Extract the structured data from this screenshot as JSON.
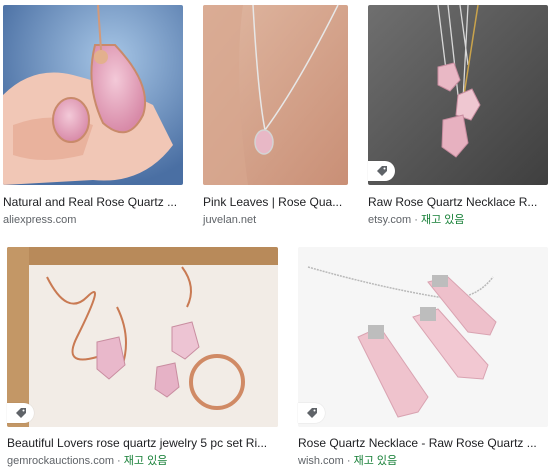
{
  "results": [
    {
      "title": "Natural and Real Rose Quartz ...",
      "source": "aliexpress.com",
      "stock": ""
    },
    {
      "title": "Pink Leaves | Rose Qua...",
      "source": "juvelan.net",
      "stock": ""
    },
    {
      "title": "Raw Rose Quartz Necklace R...",
      "source": "etsy.com",
      "sep": " · ",
      "stock": "재고 있음",
      "tag_icon": "tag-icon"
    },
    {
      "title": "Beautiful Lovers rose quartz jewelry 5 pc set Ri...",
      "source": "gemrockauctions.com",
      "sep": " · ",
      "stock": "재고 있음",
      "tag_icon": "tag-icon"
    },
    {
      "title": "Rose Quartz Necklace - Raw Rose Quartz ...",
      "source": "wish.com",
      "sep": " · ",
      "stock": "재고 있음",
      "tag_icon": "tag-icon"
    }
  ],
  "colors": {
    "stock": "#188038",
    "title": "#202124",
    "meta": "#5f6368"
  }
}
